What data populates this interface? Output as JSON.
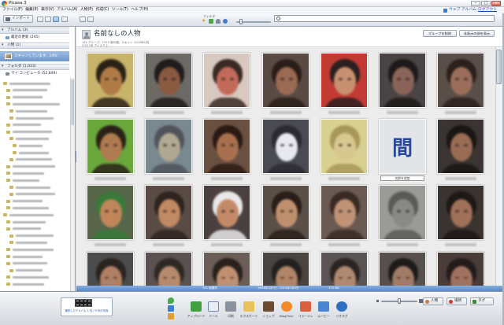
{
  "window": {
    "title": "Picasa 3",
    "controls": {
      "minimize": "–",
      "maximize": "□",
      "close": "×"
    }
  },
  "menu": {
    "items": [
      "ファイル(F)",
      "編集(E)",
      "表示(V)",
      "アルバム(A)",
      "人物(P)",
      "作成(C)",
      "ツール(T)",
      "ヘルプ(H)"
    ],
    "web_album": "ウェブ アルバム",
    "logout": "ログアウト"
  },
  "toolbar": {
    "import_label": "インポート",
    "filter_label": "フィルタ",
    "filter_star": "★",
    "search_placeholder": ""
  },
  "sidebar": {
    "albums_header": "アルバム (3)",
    "recent": "最近の更新 (245)",
    "people_header": "人物 (1)",
    "scanning": "スキャンしています、14%",
    "folders_header": "フォルダ (1,033)",
    "my_computer": "マイ コンピュータ (52,849)",
    "collapse_glyph": "▾"
  },
  "main": {
    "title": "名前なしの人物",
    "info_line1": "101 グループ、1573 個の顔、スキャン 1/12584 枚",
    "info_line2": "2.32 GB ディスク上",
    "delete_group_label": "グループを削除",
    "show_hidden_label": "非表示の顔を表示",
    "add_name_label": "名前を追加",
    "faces": [
      {
        "bg": "#c8b36a",
        "skin": "#b07a46",
        "hair": "#2a2218"
      },
      {
        "bg": "#6d6a66",
        "skin": "#8a5a40",
        "hair": "#1e1c1c"
      },
      {
        "bg": "#d8c8c0",
        "skin": "#c26a5a",
        "hair": "#3a2a24"
      },
      {
        "bg": "#5a4a44",
        "skin": "#9a6a52",
        "hair": "#2a1e1a"
      },
      {
        "bg": "#c23a34",
        "skin": "#c89070",
        "hair": "#2a2020"
      },
      {
        "bg": "#4a4444",
        "skin": "#8a6458",
        "hair": "#1e1a1a"
      },
      {
        "bg": "#5a4e48",
        "skin": "#9a6e5a",
        "hair": "#2a201c"
      },
      {
        "bg": "#6aa83c",
        "skin": "#b07a50",
        "hair": "#2a2218"
      },
      {
        "bg": "#7a8890",
        "skin": "#b0a890",
        "hair": "#50545a"
      },
      {
        "bg": "#6a5040",
        "skin": "#a8704e",
        "hair": "#2a1a14"
      },
      {
        "bg": "#4a4a52",
        "skin": "#e8e8f0",
        "hair": "#2a2a30"
      },
      {
        "bg": "#d8d090",
        "skin": "#d8c890",
        "hair": "#a89858"
      },
      {
        "type": "card",
        "glyph": "間",
        "bg": "#e2e5e8",
        "ink": "#2747a0"
      },
      {
        "bg": "#3a3432",
        "skin": "#9a6c54",
        "hair": "#1a1614"
      },
      {
        "bg": "#58664a",
        "skin": "#c0865a",
        "hair": "#3a7a3a"
      },
      {
        "bg": "#5a4c44",
        "skin": "#c08a62",
        "hair": "#2e2420"
      },
      {
        "bg": "#4a4040",
        "skin": "#c48a68",
        "hair": "#e8e8e8"
      },
      {
        "bg": "#5a5048",
        "skin": "#c0906e",
        "hair": "#2a1e1a"
      },
      {
        "bg": "#6a5a52",
        "skin": "#c09276",
        "hair": "#3a2a24"
      },
      {
        "bg": "#9a9a96",
        "skin": "#8a8a84",
        "hair": "#5a5a58"
      },
      {
        "bg": "#3a3430",
        "skin": "#a07058",
        "hair": "#1e1816"
      },
      {
        "bg": "#4a4c4e",
        "skin": "#b08064",
        "hair": "#2a2420"
      },
      {
        "bg": "#5a5250",
        "skin": "#b88a6c",
        "hair": "#2e2824"
      },
      {
        "bg": "#6a5e56",
        "skin": "#c09070",
        "hair": "#2a201c"
      },
      {
        "bg": "#4a4440",
        "skin": "#b08466",
        "hair": "#222020"
      },
      {
        "bg": "#5a5454",
        "skin": "#b08a70",
        "hair": "#2a2422"
      },
      {
        "bg": "#58504c",
        "skin": "#a07c66",
        "hair": "#1e1c1a"
      },
      {
        "bg": "#4a3c38",
        "skin": "#a07260",
        "hair": "#231c1a"
      }
    ]
  },
  "status": {
    "left": "101 個選択",
    "center": "1903年1月1日 - 2010年1月5日",
    "right": "373 MB"
  },
  "tray": {
    "text": "選択したアルバム 1 件 / 9 件の写真"
  },
  "actions": [
    {
      "label": "アップロード",
      "icon": "upload-icon",
      "color": "#3da23d"
    },
    {
      "label": "メール",
      "icon": "email-icon",
      "color": "#e8eef6"
    },
    {
      "label": "印刷",
      "icon": "printer-icon",
      "color": "#8a929c"
    },
    {
      "label": "エクスポート",
      "icon": "folder-icon",
      "color": "#e7c35a"
    },
    {
      "label": "ショップ",
      "icon": "shopping-bag-icon",
      "color": "#6a4a30"
    },
    {
      "label": "BlogThis!",
      "icon": "blogger-icon",
      "color": "#f08a24"
    },
    {
      "label": "コラージュ",
      "icon": "collage-icon",
      "color": "#d9603a"
    },
    {
      "label": "ムービー",
      "icon": "movie-icon",
      "color": "#4a86d0"
    },
    {
      "label": "ジオタグ",
      "icon": "globe-icon",
      "color": "#2f6fc0"
    }
  ],
  "right_tabs": {
    "people": "人物",
    "places": "場所",
    "tags": "タグ"
  }
}
